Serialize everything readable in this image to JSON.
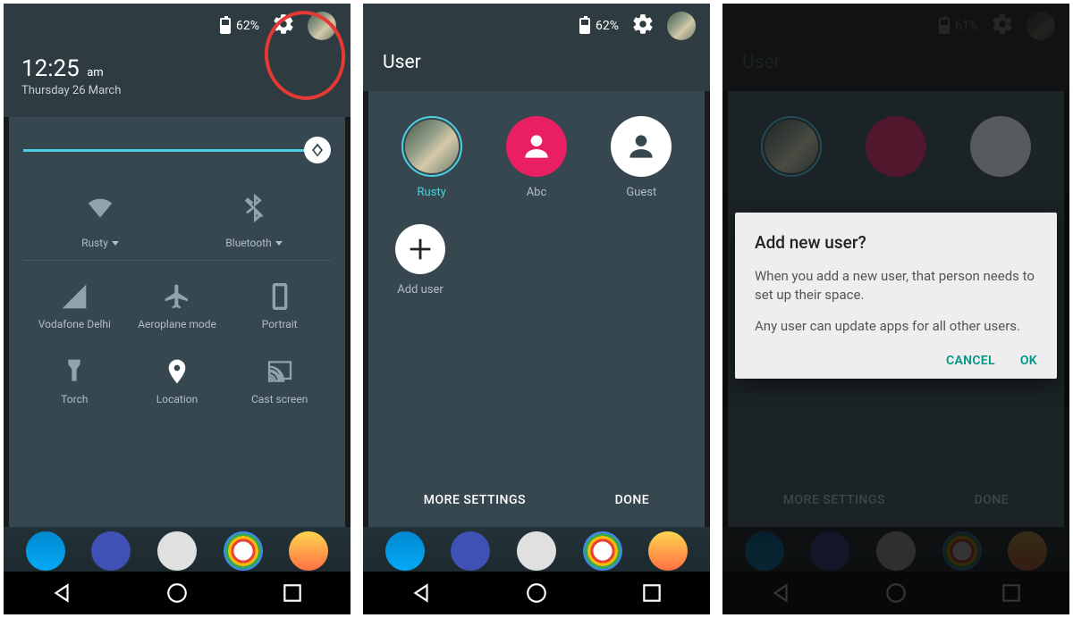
{
  "phone1": {
    "battery_pct": "62%",
    "time": "12:25",
    "ampm": "am",
    "date": "Thursday 26 March",
    "tiles_top": {
      "wifi_label": "Rusty",
      "bt_label": "Bluetooth"
    },
    "tiles": [
      {
        "label": "Vodafone Delhi"
      },
      {
        "label": "Aeroplane mode"
      },
      {
        "label": "Portrait"
      },
      {
        "label": "Torch"
      },
      {
        "label": "Location"
      },
      {
        "label": "Cast screen"
      }
    ]
  },
  "phone2": {
    "battery_pct": "62%",
    "header": "User",
    "users": [
      {
        "label": "Rusty"
      },
      {
        "label": "Abc"
      },
      {
        "label": "Guest"
      }
    ],
    "add_label": "Add user",
    "more_settings": "MORE SETTINGS",
    "done": "DONE"
  },
  "phone3": {
    "battery_pct": "61%",
    "header": "User",
    "more_settings": "MORE SETTINGS",
    "done": "DONE",
    "dialog": {
      "title": "Add new user?",
      "line1": "When you add a new user, that person needs to set up their space.",
      "line2": "Any user can update apps for all other users.",
      "cancel": "CANCEL",
      "ok": "OK"
    }
  }
}
